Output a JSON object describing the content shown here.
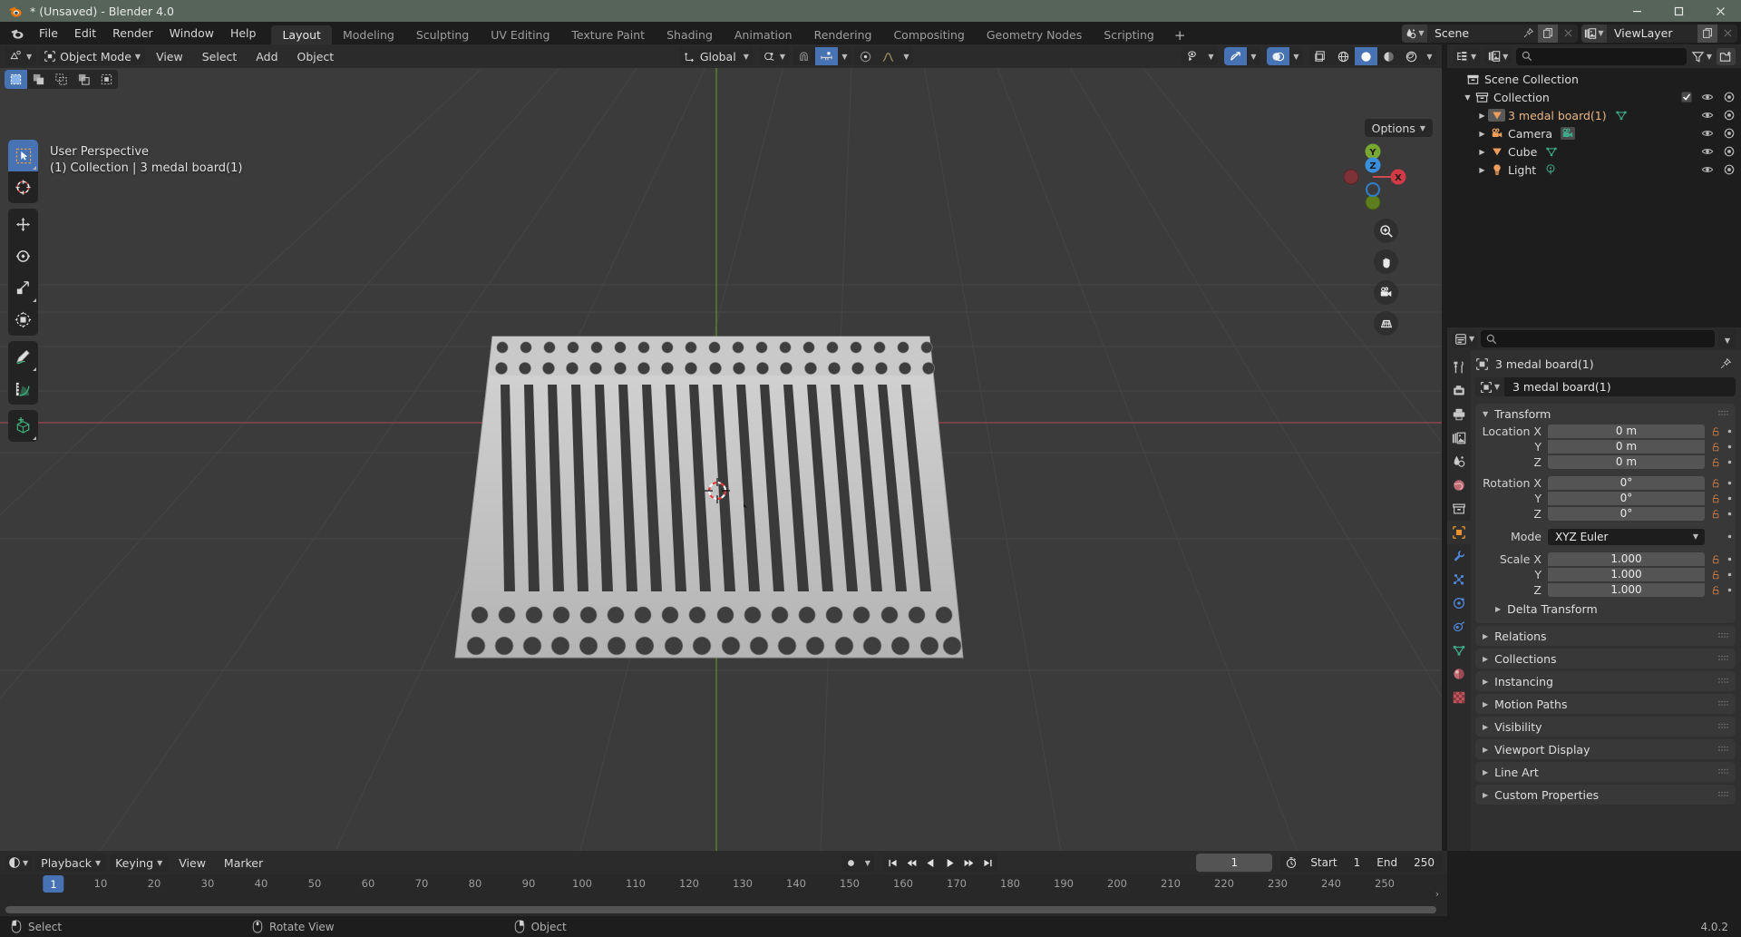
{
  "window": {
    "title": "* (Unsaved) - Blender 4.0",
    "minimize": "—",
    "maximize": "▢",
    "close": "✕"
  },
  "topbar": {
    "menus": [
      "File",
      "Edit",
      "Render",
      "Window",
      "Help"
    ],
    "workspaces": [
      {
        "label": "Layout",
        "active": true
      },
      {
        "label": "Modeling",
        "active": false
      },
      {
        "label": "Sculpting",
        "active": false
      },
      {
        "label": "UV Editing",
        "active": false
      },
      {
        "label": "Texture Paint",
        "active": false
      },
      {
        "label": "Shading",
        "active": false
      },
      {
        "label": "Animation",
        "active": false
      },
      {
        "label": "Rendering",
        "active": false
      },
      {
        "label": "Compositing",
        "active": false
      },
      {
        "label": "Geometry Nodes",
        "active": false
      },
      {
        "label": "Scripting",
        "active": false
      }
    ],
    "add_workspace": "+",
    "scene_name": "Scene",
    "viewlayer_name": "ViewLayer"
  },
  "viewport": {
    "mode": "Object Mode",
    "menus": [
      "View",
      "Select",
      "Add",
      "Object"
    ],
    "transform_orientation": "Global",
    "options_label": "Options",
    "overlay_line1": "User Perspective",
    "overlay_line2": "(1) Collection | 3 medal board(1)",
    "gizmo_axes": {
      "x": "X",
      "y": "Y",
      "z": "Z"
    },
    "tools": [
      "tweak-select-tool",
      "cursor-tool",
      "move-tool",
      "rotate-tool",
      "scale-tool",
      "transform-tool",
      "annotate-tool",
      "measure-tool",
      "add-cube-tool"
    ],
    "nav_buttons": [
      "zoom-icon",
      "pan-hand-icon",
      "camera-view-icon",
      "perspective-toggle-icon"
    ]
  },
  "outliner": {
    "search_placeholder": "",
    "rows": [
      {
        "label": "Scene Collection",
        "icon": "scene-collection-icon",
        "indent": 0,
        "disclosure": "",
        "restrict": false,
        "selected": false
      },
      {
        "label": "Collection",
        "icon": "collection-icon",
        "indent": 1,
        "disclosure": "▼",
        "restrict": true,
        "checkbox": true,
        "selected": false
      },
      {
        "label": "3 medal board(1)",
        "icon": "mesh-object-icon",
        "indent": 2,
        "disclosure": "▶",
        "restrict": true,
        "data_icon": "mesh-data-icon",
        "selected": true
      },
      {
        "label": "Camera",
        "icon": "camera-object-icon",
        "indent": 2,
        "disclosure": "▶",
        "restrict": true,
        "data_icon": "camera-data-icon",
        "selected": false
      },
      {
        "label": "Cube",
        "icon": "mesh-object-icon",
        "indent": 2,
        "disclosure": "▶",
        "restrict": true,
        "data_icon": "mesh-data-icon",
        "selected": false
      },
      {
        "label": "Light",
        "icon": "light-object-icon",
        "indent": 2,
        "disclosure": "▶",
        "restrict": true,
        "data_icon": "light-data-icon",
        "selected": false
      }
    ]
  },
  "properties": {
    "search_placeholder": "",
    "breadcrumb": "3 medal board(1)",
    "object_name": "3 medal board(1)",
    "tabs": [
      {
        "name": "tool-tab",
        "active": false
      },
      {
        "name": "render-tab",
        "active": false
      },
      {
        "name": "output-tab",
        "active": false
      },
      {
        "name": "view-layer-tab",
        "active": false
      },
      {
        "name": "scene-tab",
        "active": false
      },
      {
        "name": "world-tab",
        "active": false
      },
      {
        "name": "collection-tab",
        "active": false
      },
      {
        "name": "object-tab",
        "active": true
      },
      {
        "name": "modifier-tab",
        "active": false
      },
      {
        "name": "particles-tab",
        "active": false
      },
      {
        "name": "physics-tab",
        "active": false
      },
      {
        "name": "constraints-tab",
        "active": false
      },
      {
        "name": "object-data-tab",
        "active": false
      },
      {
        "name": "material-tab",
        "active": false
      },
      {
        "name": "texture-tab",
        "active": false
      }
    ],
    "transform": {
      "title": "Transform",
      "location_label": "Location X",
      "location": [
        "0 m",
        "0 m",
        "0 m"
      ],
      "rotation_label": "Rotation X",
      "rotation": [
        "0°",
        "0°",
        "0°"
      ],
      "mode_label": "Mode",
      "mode_value": "XYZ Euler",
      "scale_label": "Scale X",
      "scale": [
        "1.000",
        "1.000",
        "1.000"
      ],
      "axis_y": "Y",
      "axis_z": "Z",
      "delta_transform": "Delta Transform"
    },
    "panels": [
      "Relations",
      "Collections",
      "Instancing",
      "Motion Paths",
      "Visibility",
      "Viewport Display",
      "Line Art",
      "Custom Properties"
    ]
  },
  "timeline": {
    "menus": [
      "Playback",
      "Keying",
      "View",
      "Marker"
    ],
    "current_frame": "1",
    "start_label": "Start",
    "start_value": "1",
    "end_label": "End",
    "end_value": "250",
    "ticks": [
      10,
      20,
      30,
      40,
      50,
      60,
      70,
      80,
      90,
      100,
      110,
      120,
      130,
      140,
      150,
      160,
      170,
      180,
      190,
      200,
      210,
      220,
      230,
      240,
      250
    ],
    "playhead_frame": "1"
  },
  "statusbar": {
    "items": [
      {
        "icon": "mouse-left-icon",
        "label": "Select"
      },
      {
        "icon": "mouse-middle-icon",
        "label": "Rotate View"
      },
      {
        "icon": "mouse-right-icon",
        "label": "Object"
      }
    ],
    "version": "4.0.2"
  },
  "colors": {
    "accent_blue": "#4772b3",
    "title_bar": "#56645a",
    "viewport_bg": "#3b3b3b",
    "axis_x_red": "#bb4a56",
    "axis_y_green": "#6a9b2f",
    "mesh_gray": "#c6c6c6",
    "object_orange": "#ed9e5c"
  }
}
